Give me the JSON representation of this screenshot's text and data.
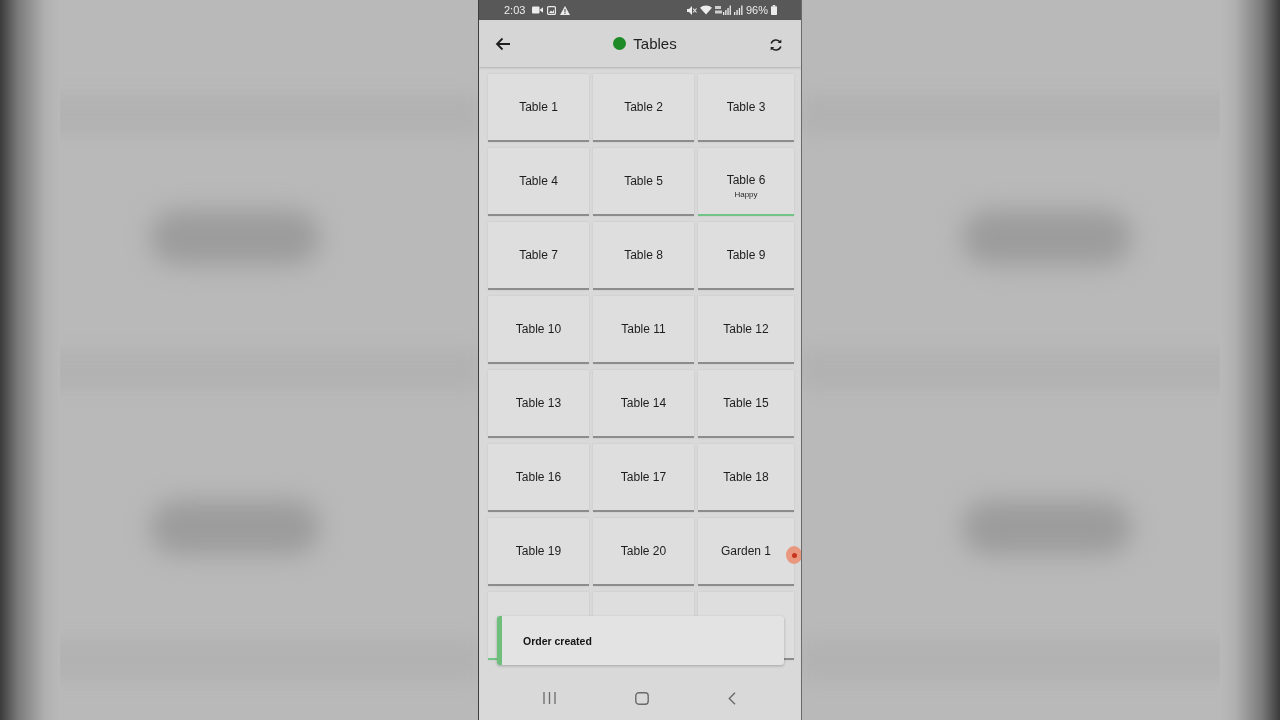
{
  "status_bar": {
    "time": "2:03",
    "battery": "96%"
  },
  "header": {
    "title": "Tables",
    "connected": true
  },
  "tables": [
    {
      "label": "Table 1",
      "occupied": false
    },
    {
      "label": "Table 2",
      "occupied": false
    },
    {
      "label": "Table 3",
      "occupied": false
    },
    {
      "label": "Table 4",
      "occupied": false
    },
    {
      "label": "Table 5",
      "occupied": false
    },
    {
      "label": "Table 6",
      "note": "Happy",
      "occupied": true
    },
    {
      "label": "Table 7",
      "occupied": false
    },
    {
      "label": "Table 8",
      "occupied": false
    },
    {
      "label": "Table 9",
      "occupied": false
    },
    {
      "label": "Table 10",
      "occupied": false
    },
    {
      "label": "Table 11",
      "occupied": false
    },
    {
      "label": "Table 12",
      "occupied": false
    },
    {
      "label": "Table 13",
      "occupied": false
    },
    {
      "label": "Table 14",
      "occupied": false
    },
    {
      "label": "Table 15",
      "occupied": false
    },
    {
      "label": "Table 16",
      "occupied": false
    },
    {
      "label": "Table 17",
      "occupied": false
    },
    {
      "label": "Table 18",
      "occupied": false
    },
    {
      "label": "Table 19",
      "occupied": false
    },
    {
      "label": "Table 20",
      "occupied": false
    },
    {
      "label": "Garden 1",
      "occupied": false
    },
    {
      "occupied": true
    }
  ],
  "toast": {
    "message": "Order created"
  }
}
